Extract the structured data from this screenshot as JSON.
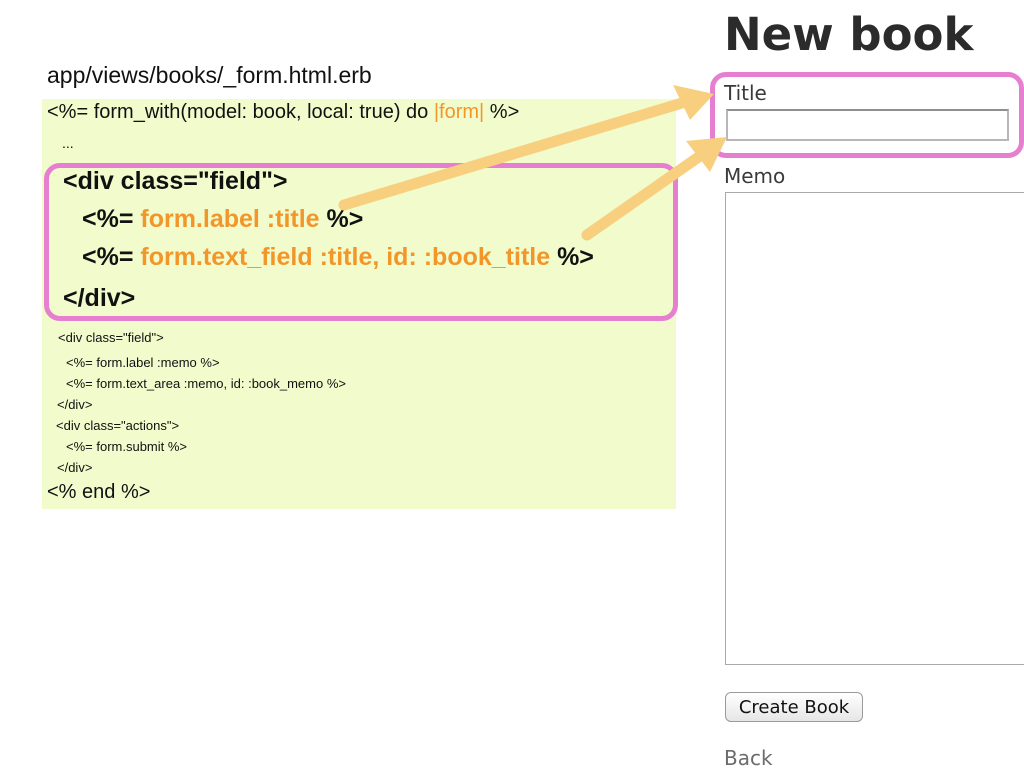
{
  "slide": {
    "file_path": "app/views/books/_form.html.erb",
    "code": {
      "open_prefix": "<%= form_with(model: book, local: true) do ",
      "open_block_var": "|form|",
      "open_suffix": " %>",
      "ellipsis": "...",
      "field_div_open": "<div class=\"field\">",
      "label_prefix": "<%= ",
      "label_code": "form.label :title",
      "label_suffix": " %>",
      "text_field_prefix": "<%= ",
      "text_field_code": "form.text_field :title, id: :book_title",
      "text_field_suffix": " %>",
      "field_div_close": "</div>",
      "memo_div_open": "<div class=\"field\">",
      "memo_label": "<%= form.label :memo %>",
      "memo_text_area": "<%= form.text_area :memo, id: :book_memo %>",
      "memo_div_close": "</div>",
      "actions_div_open": "<div class=\"actions\">",
      "submit": "<%= form.submit %>",
      "actions_div_close": "</div>",
      "end": "<% end %>"
    }
  },
  "page": {
    "heading": "New book",
    "title_label": "Title",
    "title_value": "",
    "memo_label": "Memo",
    "memo_value": "",
    "submit_label": "Create Book",
    "back_link": "Back"
  },
  "colors": {
    "code_background": "#f1fbcc",
    "highlight_text": "#f3962a",
    "callout_border": "#e77fd1",
    "arrow": "#f7cf7f"
  }
}
